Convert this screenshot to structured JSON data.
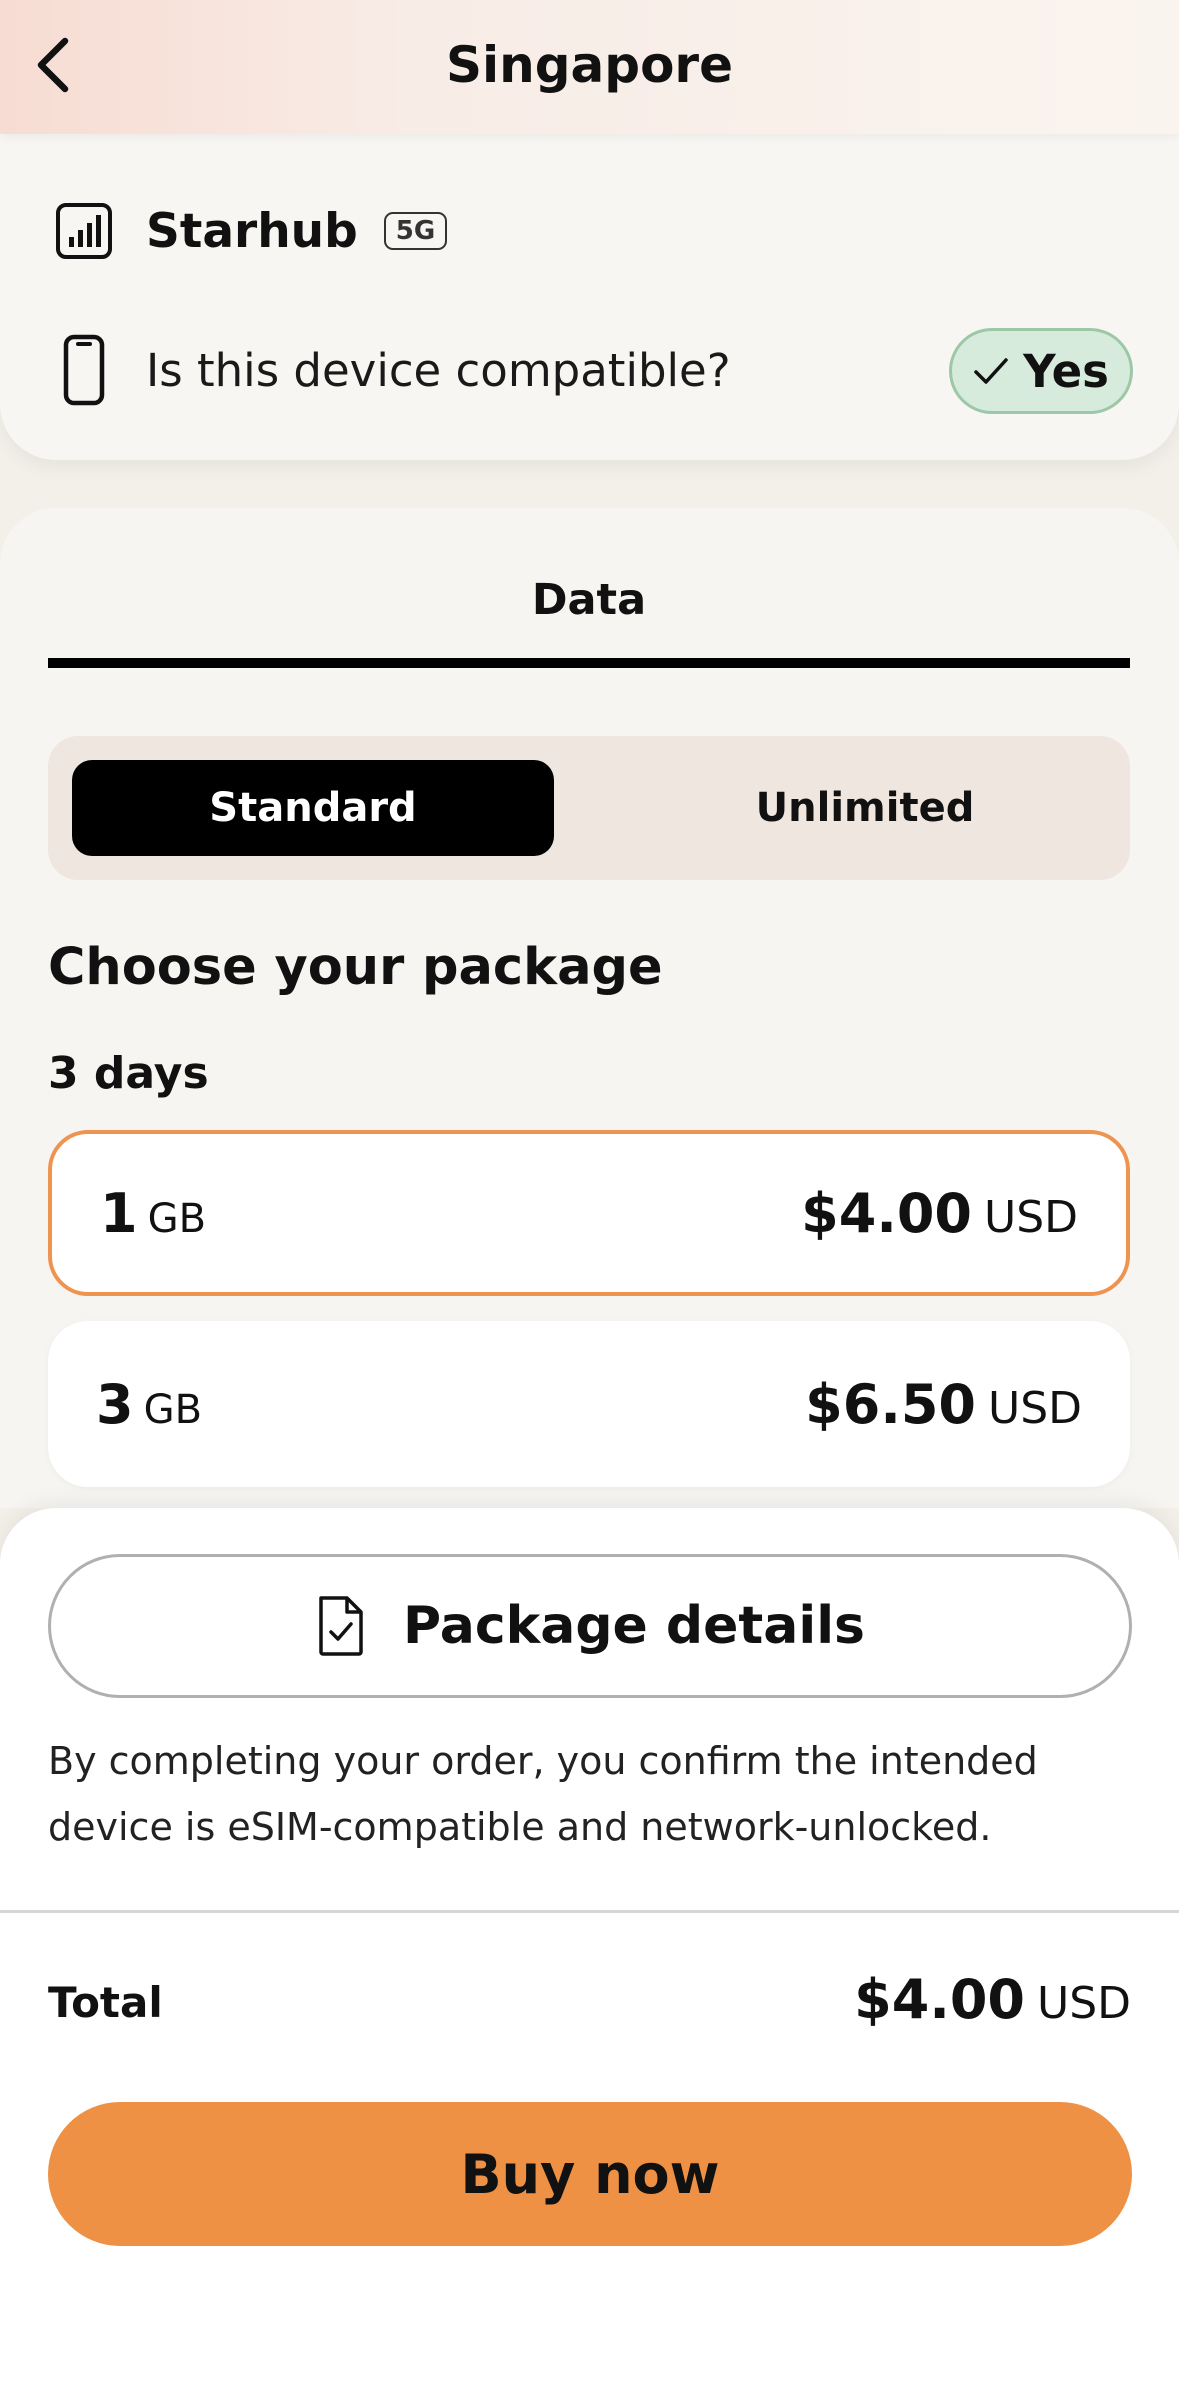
{
  "header": {
    "title": "Singapore"
  },
  "carrier": {
    "name": "Starhub",
    "network_badge": "5G",
    "compat_question": "Is this device compatible?",
    "compat_answer": "Yes"
  },
  "data_card": {
    "tab_label": "Data",
    "segments": {
      "standard": "Standard",
      "unlimited": "Unlimited",
      "selected": "Standard"
    },
    "choose_title": "Choose your package",
    "duration_label": "3 days",
    "packages": [
      {
        "amount": "1",
        "unit": "GB",
        "price": "$4.00",
        "currency": "USD",
        "selected": true
      },
      {
        "amount": "3",
        "unit": "GB",
        "price": "$6.50",
        "currency": "USD",
        "selected": false
      }
    ]
  },
  "bottom": {
    "details_label": "Package details",
    "disclaimer": "By completing your order, you confirm the intended device is eSIM-compatible and network-unlocked.",
    "total_label": "Total",
    "total_price": "$4.00",
    "total_currency": "USD",
    "buy_label": "Buy now"
  },
  "colors": {
    "accent_orange": "#ee9144",
    "selected_border": "#ee9450",
    "yes_bg": "#d6ebdc",
    "yes_border": "#9cc8a7"
  },
  "icons": {
    "back": "chevron-left-icon",
    "signal": "signal-bars-icon",
    "device": "smartphone-icon",
    "check": "check-icon",
    "document": "document-check-icon"
  }
}
